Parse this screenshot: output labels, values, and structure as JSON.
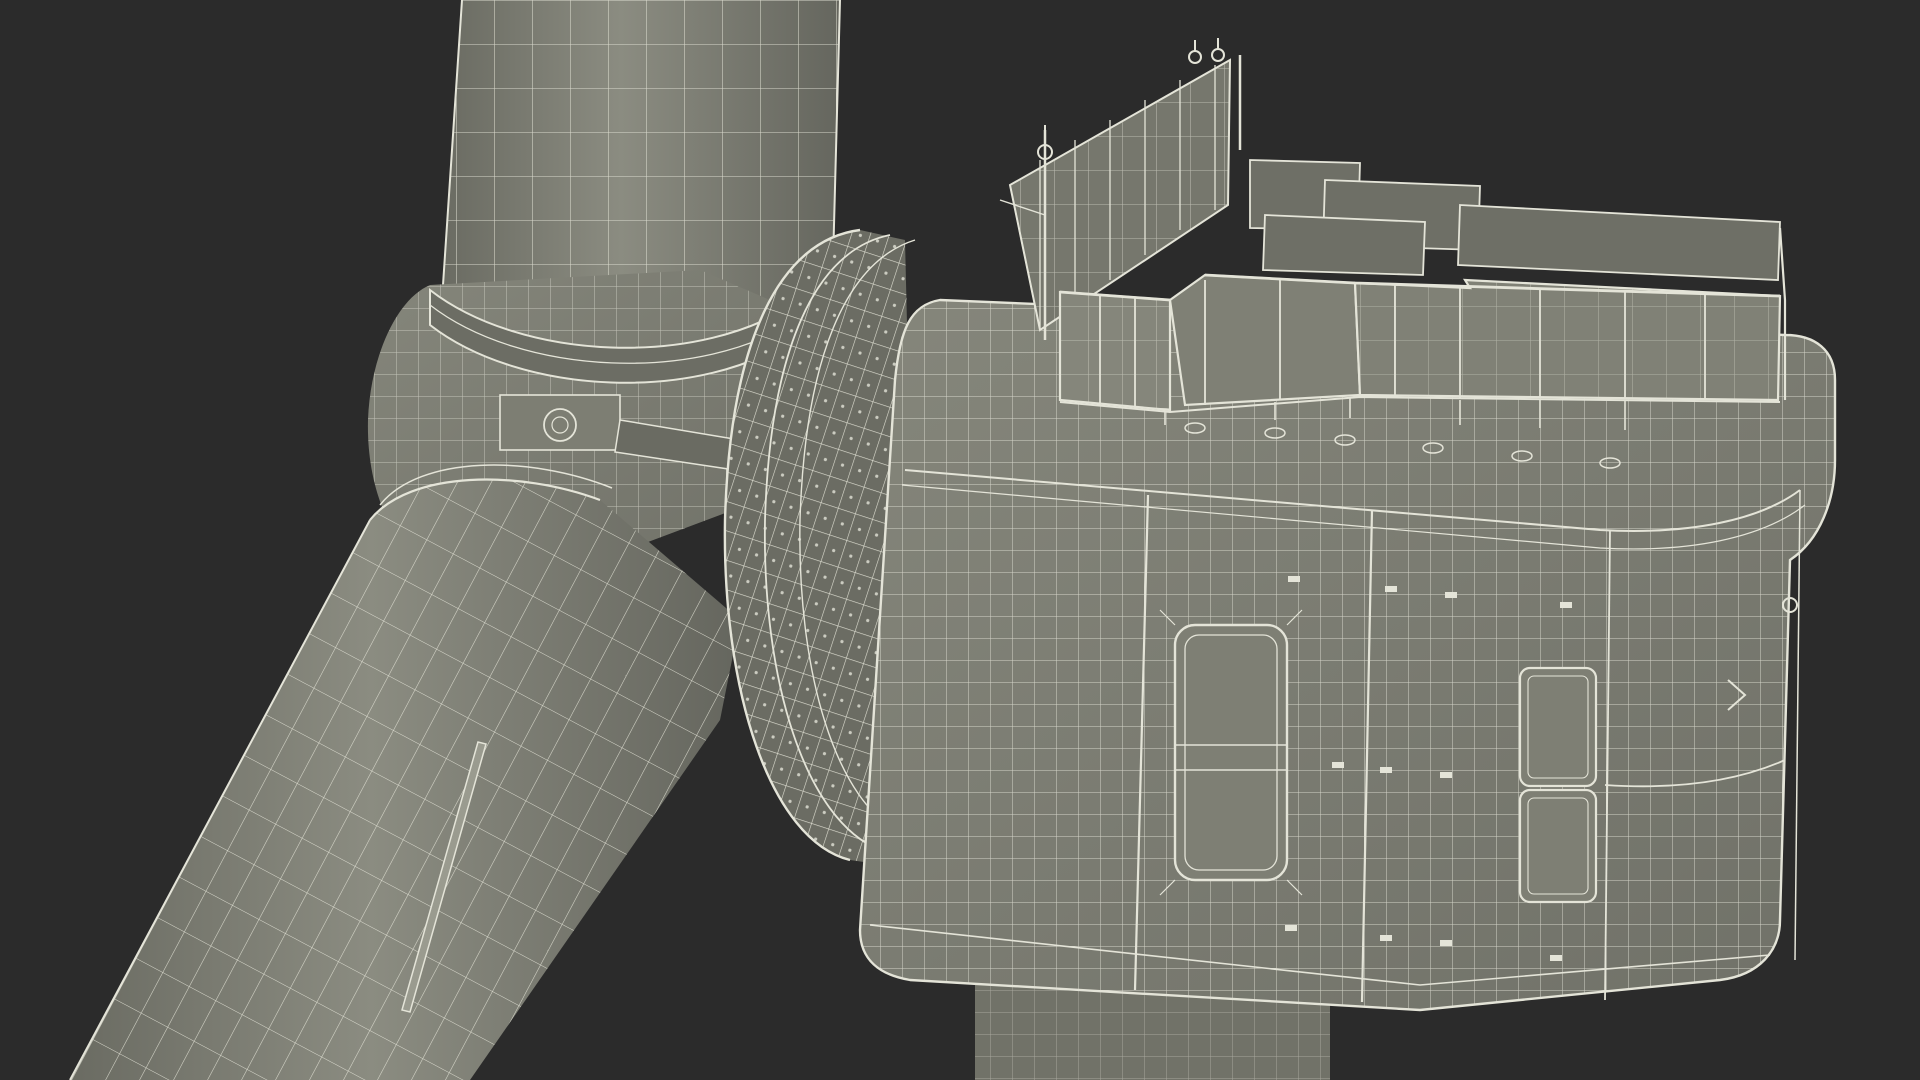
{
  "scene": {
    "subject": "wind-turbine-nacelle-wireframe",
    "palette": {
      "background": "#2b2b2b",
      "surface": "#7a7b70",
      "surface_light": "#8a8b80",
      "surface_dark": "#5f6058",
      "wire": "#e4e4d8",
      "wire_dim": "#c9c9bd",
      "shadow": "#4c4d47"
    },
    "components": [
      "blade-upper",
      "blade-lower",
      "rotor-hub",
      "hub-ring",
      "nacelle-housing",
      "helipad-railing",
      "meteorological-mast",
      "tower-top",
      "maintenance-hatch"
    ]
  }
}
